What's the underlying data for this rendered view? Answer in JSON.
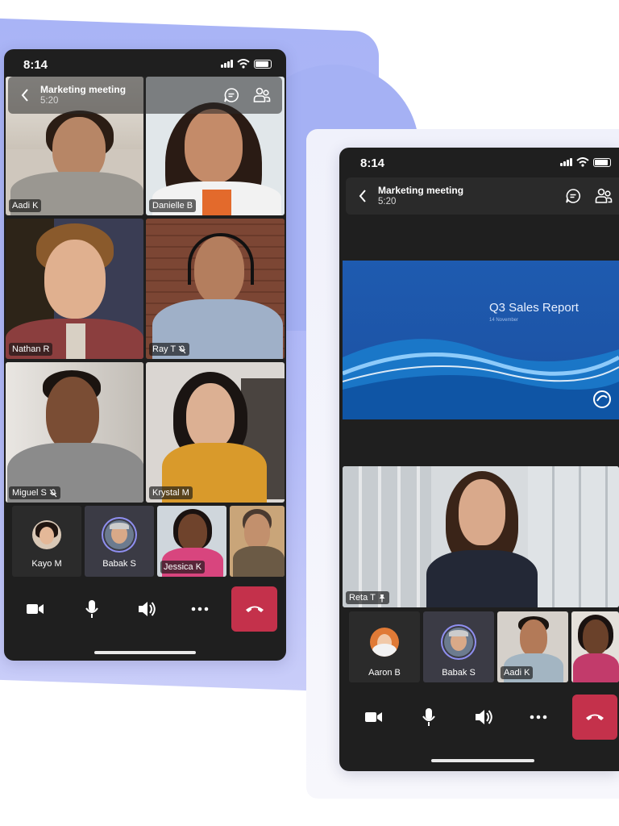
{
  "colors": {
    "accent": "#8f8ff0",
    "end_call": "#c4314b",
    "background_blob": "#a9b4f6",
    "phone_bg": "#1f1f1f"
  },
  "phone_left": {
    "status": {
      "time": "8:14"
    },
    "header": {
      "title": "Marketing meeting",
      "duration": "5:20",
      "icons": [
        "chevron-left-icon",
        "chat-icon",
        "participants-icon"
      ]
    },
    "video_tiles": [
      {
        "name": "Aadi K",
        "muted": false
      },
      {
        "name": "Danielle B",
        "muted": false
      },
      {
        "name": "Nathan R",
        "muted": false
      },
      {
        "name": "Ray T",
        "muted": true
      },
      {
        "name": "Miguel S",
        "muted": true
      },
      {
        "name": "Krystal M",
        "muted": false
      }
    ],
    "roster": [
      {
        "name": "Kayo M",
        "type": "avatar"
      },
      {
        "name": "Babak S",
        "type": "avatar",
        "selected": true
      },
      {
        "name": "Jessica K",
        "type": "video"
      },
      {
        "name": "",
        "type": "video"
      }
    ],
    "controls": [
      "camera-icon",
      "microphone-icon",
      "speaker-icon",
      "more-icon",
      "end-call-icon"
    ]
  },
  "phone_right": {
    "status": {
      "time": "8:14"
    },
    "header": {
      "title": "Marketing meeting",
      "duration": "5:20",
      "icons": [
        "chevron-left-icon",
        "chat-icon",
        "participants-icon"
      ]
    },
    "shared_content": {
      "title": "Q3 Sales Report",
      "date": "14 November"
    },
    "spotlight": {
      "name": "Reta T",
      "pinned": true
    },
    "roster": [
      {
        "name": "Aaron B",
        "type": "avatar"
      },
      {
        "name": "Babak S",
        "type": "avatar",
        "selected": true
      },
      {
        "name": "Aadi K",
        "type": "video"
      },
      {
        "name": "",
        "type": "video"
      }
    ],
    "controls": [
      "camera-icon",
      "microphone-icon",
      "speaker-icon",
      "more-icon",
      "end-call-icon"
    ]
  }
}
